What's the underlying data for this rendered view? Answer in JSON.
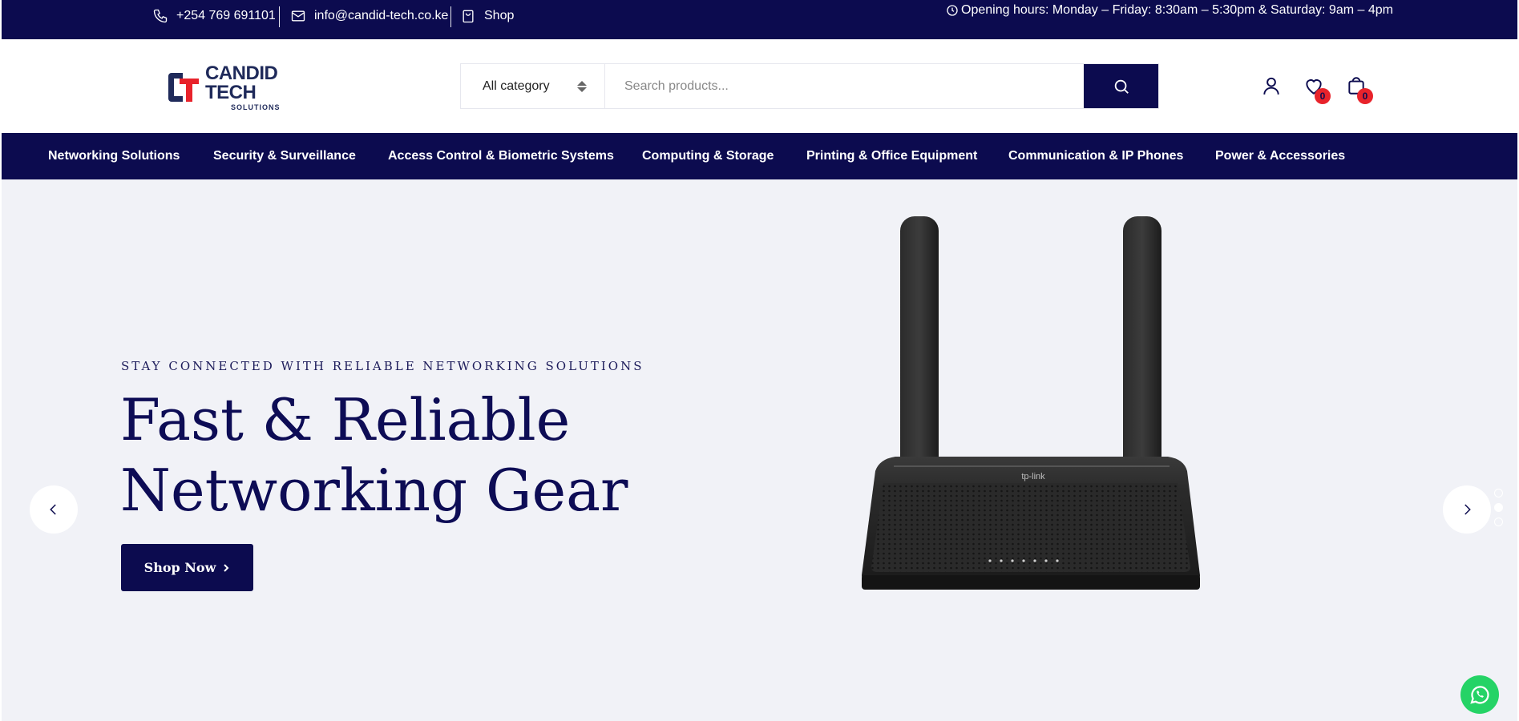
{
  "topbar": {
    "phone": "+254 769 691101",
    "email": "info@candid-tech.co.ke",
    "shop": "Shop",
    "hours": "Opening hours: Monday – Friday: 8:30am – 5:30pm & Saturday: 9am – 4pm"
  },
  "logo": {
    "line1": "CANDID",
    "line2": "TECH",
    "line3": "SOLUTIONS"
  },
  "search": {
    "category": "All category",
    "placeholder": "Search products..."
  },
  "header_icons": {
    "wishlist_count": "0",
    "cart_count": "0"
  },
  "nav": [
    "Networking Solutions",
    "Security & Surveillance",
    "Access Control & Biometric Systems",
    "Computing & Storage",
    "Printing & Office Equipment",
    "Communication & IP Phones",
    "Power & Accessories"
  ],
  "hero": {
    "kicker": "STAY CONNECTED WITH RELIABLE NETWORKING SOLUTIONS",
    "title_line1": "Fast & Reliable",
    "title_line2": "Networking Gear",
    "cta": "Shop Now",
    "router_brand": "tp-link"
  },
  "slider": {
    "slides": 3,
    "active": 2
  },
  "colors": {
    "brand": "#0c0b4f",
    "badge": "#e8232b",
    "hero_bg": "#f1f2f7",
    "whatsapp": "#25d366"
  }
}
